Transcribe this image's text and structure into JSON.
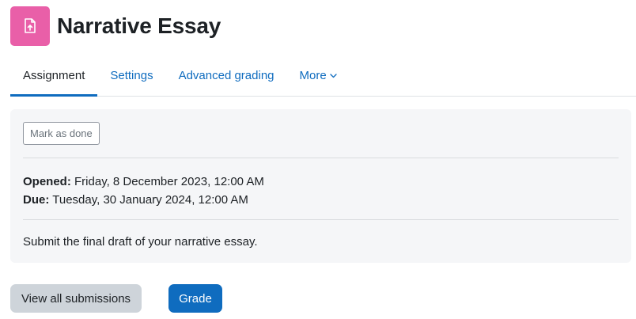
{
  "header": {
    "title": "Narrative Essay",
    "icon": "assignment-icon",
    "icon_color": "#e95fa8"
  },
  "tabs": [
    {
      "label": "Assignment",
      "active": true
    },
    {
      "label": "Settings"
    },
    {
      "label": "Advanced grading"
    },
    {
      "label": "More"
    }
  ],
  "panel": {
    "mark_done_label": "Mark as done",
    "opened_label": "Opened:",
    "opened_value": "Friday, 8 December 2023, 12:00 AM",
    "due_label": "Due:",
    "due_value": "Tuesday, 30 January 2024, 12:00 AM",
    "description": "Submit the final draft of your narrative essay."
  },
  "actions": {
    "view_submissions_label": "View all submissions",
    "grade_label": "Grade"
  },
  "colors": {
    "accent": "#0f6cbf",
    "secondary_button": "#ced4da",
    "panel_background": "#f5f6f8"
  }
}
